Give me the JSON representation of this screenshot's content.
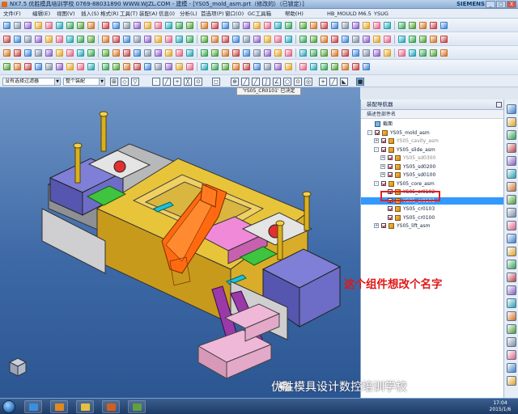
{
  "window": {
    "title": "NX7.5 优胜模具培训学校 0769-88031890 WWW.WJZL.COM - 建模 - [YS05_mold_asm.prt（修改的）（已锁定）]",
    "siemens": "SIEMENS",
    "buttons": [
      "_",
      "□",
      "X"
    ]
  },
  "menu": {
    "items": [
      "文件(F)",
      "编辑(E)",
      "视图(V)",
      "插入(S)",
      "格式(R)",
      "工具(T)",
      "装配(A)",
      "信息(I)",
      "分析(L)",
      "首选项(P)",
      "窗口(O)",
      "GC工具箱",
      "帮助(H)",
      "HB_MOULD M6.5",
      "YSUG"
    ]
  },
  "selection": {
    "filter": "没有选择过滤器",
    "scope": "整个装配"
  },
  "viewport": {
    "title": "'YS05_CR0101' 已决定"
  },
  "navigator": {
    "title": "装配导航器",
    "column_header": "描述性部件名",
    "tree": [
      {
        "label": "截面",
        "depth": 0,
        "expand": "",
        "check": false,
        "icon": false,
        "state": "normal"
      },
      {
        "label": "YS05_mold_asm",
        "depth": 0,
        "expand": "-",
        "check": true,
        "icon": true,
        "state": "normal"
      },
      {
        "label": "YS05_cavity_asm",
        "depth": 1,
        "expand": "+",
        "check": true,
        "icon": true,
        "state": "gray"
      },
      {
        "label": "YS05_slide_asm",
        "depth": 1,
        "expand": "-",
        "check": true,
        "icon": true,
        "state": "normal"
      },
      {
        "label": "YS05_sd0300",
        "depth": 2,
        "expand": "+",
        "check": true,
        "icon": true,
        "state": "gray"
      },
      {
        "label": "YS05_sd0200",
        "depth": 2,
        "expand": "+",
        "check": true,
        "icon": true,
        "state": "normal"
      },
      {
        "label": "YS05_sd0100",
        "depth": 2,
        "expand": "+",
        "check": true,
        "icon": true,
        "state": "normal"
      },
      {
        "label": "YS05_core_asm",
        "depth": 1,
        "expand": "-",
        "check": true,
        "icon": true,
        "state": "normal"
      },
      {
        "label": "YS05_cr0102",
        "depth": 2,
        "expand": "",
        "check": true,
        "icon": true,
        "state": "normal"
      },
      {
        "label": "YS05_cr0101",
        "depth": 2,
        "expand": "",
        "check": true,
        "icon": true,
        "state": "selected"
      },
      {
        "label": "YS05_cr0103",
        "depth": 2,
        "expand": "",
        "check": true,
        "icon": true,
        "state": "normal"
      },
      {
        "label": "YS05_cr0100",
        "depth": 2,
        "expand": "",
        "check": true,
        "icon": true,
        "state": "normal"
      },
      {
        "label": "YS05_lift_asm",
        "depth": 1,
        "expand": "+",
        "check": true,
        "icon": true,
        "state": "normal"
      }
    ]
  },
  "annotation": "这个组件想改个名字",
  "watermark": "优胜模具设计数控培训学校",
  "taskbar": {
    "time": "17:04",
    "date": "2015/1/6"
  },
  "colors": {
    "selection": "#3399ff",
    "annotation": "#e01818",
    "viewport_top": "#6f95c6",
    "viewport_bottom": "#2b5692"
  }
}
